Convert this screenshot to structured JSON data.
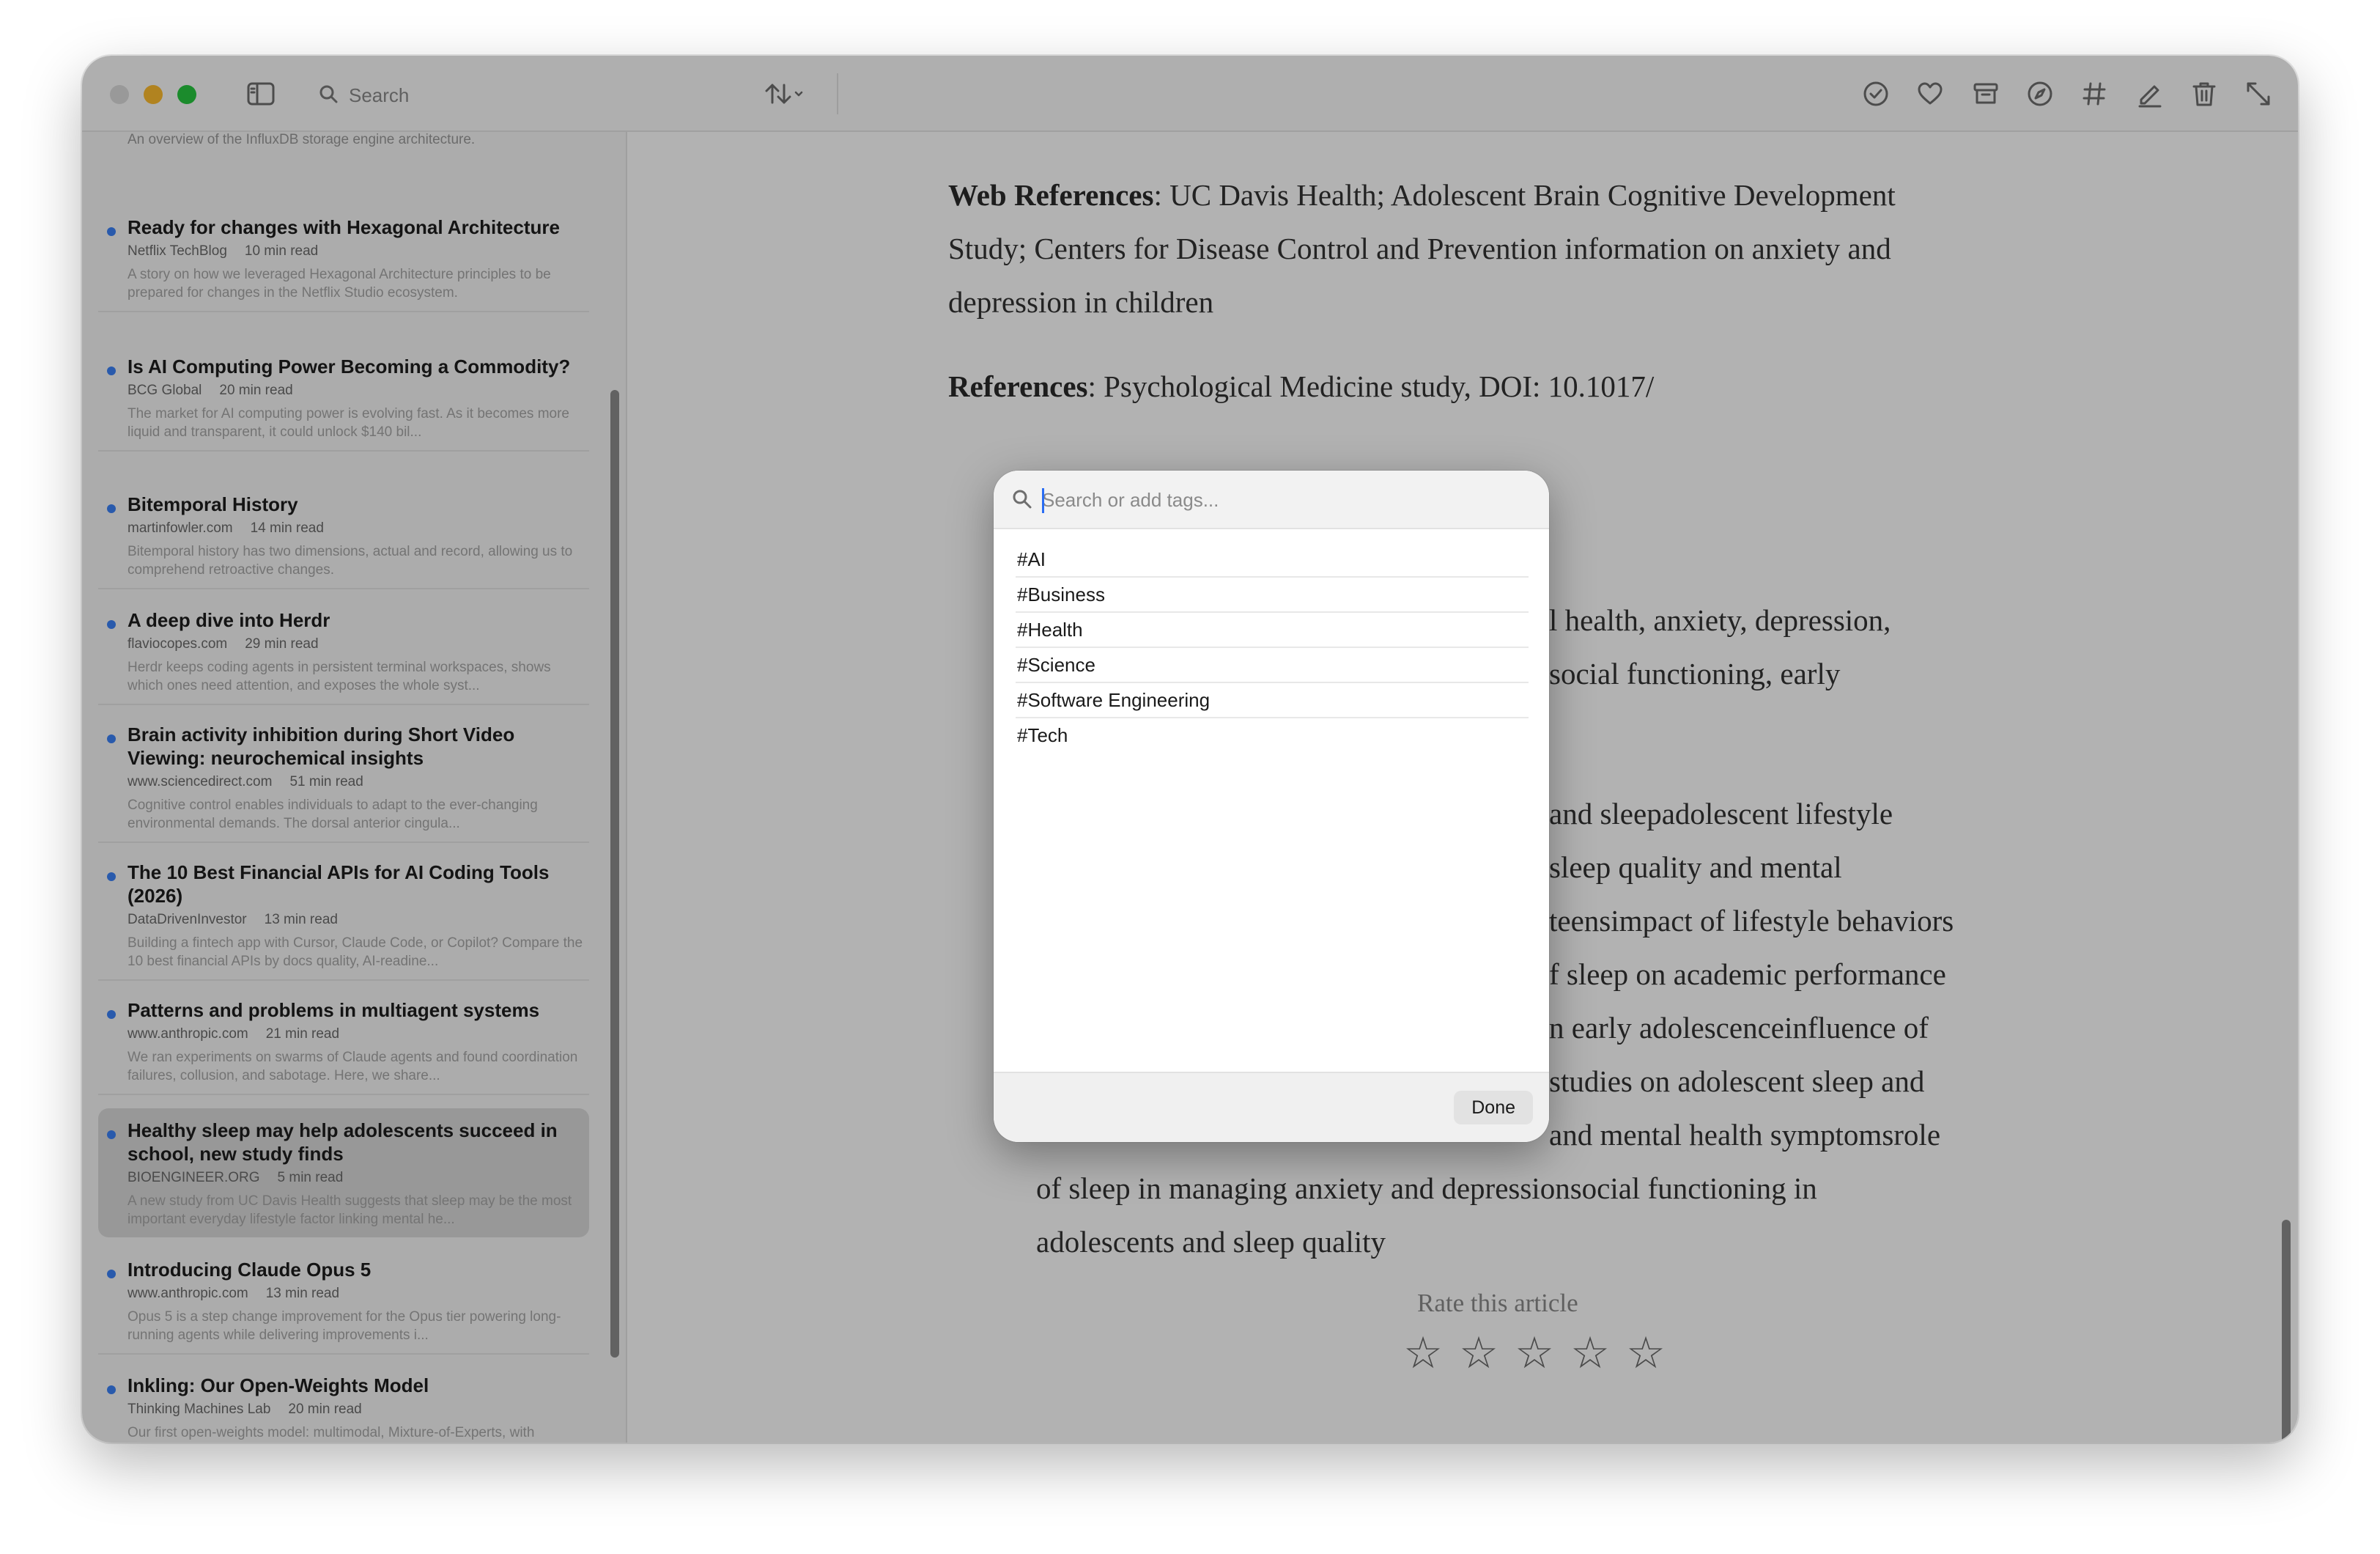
{
  "toolbar": {
    "search_label": "Search"
  },
  "sidebar": {
    "top_snippet": "An overview of the InfluxDB storage engine architecture.",
    "articles": [
      {
        "title": "Ready for changes with Hexagonal Architecture",
        "source": "Netflix TechBlog",
        "read_time": "10 min read",
        "excerpt": "A story on how we leveraged Hexagonal Architecture principles to be prepared for changes in the Netflix Studio ecosystem."
      },
      {
        "title": "Is AI Computing Power Becoming a Commodity?",
        "source": "BCG Global",
        "read_time": "20 min read",
        "excerpt": "The market for AI computing power is evolving fast. As it becomes more liquid and transparent, it could unlock $140 bil..."
      },
      {
        "title": "Bitemporal History",
        "source": "martinfowler.com",
        "read_time": "14 min read",
        "excerpt": "Bitemporal history has two dimensions, actual and record, allowing us to comprehend retroactive changes."
      },
      {
        "title": "A deep dive into Herdr",
        "source": "flaviocopes.com",
        "read_time": "29 min read",
        "excerpt": "Herdr keeps coding agents in persistent terminal workspaces, shows which ones need attention, and exposes the whole syst..."
      },
      {
        "title": "Brain activity inhibition during Short Video Viewing: neurochemical insights",
        "source": "www.sciencedirect.com",
        "read_time": "51 min read",
        "excerpt": "Cognitive control enables individuals to adapt to the ever-changing environmental demands. The dorsal anterior cingula..."
      },
      {
        "title": "The 10 Best Financial APIs for AI Coding Tools (2026)",
        "source": "DataDrivenInvestor",
        "read_time": "13 min read",
        "excerpt": "Building a fintech app with Cursor, Claude Code, or Copilot? Compare the 10 best financial APIs by docs quality, AI-readine..."
      },
      {
        "title": "Patterns and problems in multiagent systems",
        "source": "www.anthropic.com",
        "read_time": "21 min read",
        "excerpt": "We ran experiments on swarms of Claude agents and found coordination failures, collusion, and sabotage. Here, we share..."
      },
      {
        "title": "Healthy sleep may help adolescents succeed in school, new study finds",
        "source": "BIOENGINEER.ORG",
        "read_time": "5 min read",
        "excerpt": "A new study from UC Davis Health suggests that sleep may be the most important everyday lifestyle factor linking mental he...",
        "selected": true
      },
      {
        "title": "Introducing Claude Opus 5",
        "source": "www.anthropic.com",
        "read_time": "13 min read",
        "excerpt": "Opus 5 is a step change improvement for the Opus tier powering long-running agents while delivering improvements i..."
      },
      {
        "title": "Inkling: Our Open-Weights Model",
        "source": "Thinking Machines Lab",
        "read_time": "20 min read",
        "excerpt": "Our first open-weights model: multimodal, Mixture-of-Experts, with controllable reasoning effort. Available to fine-tune on Ti..."
      }
    ]
  },
  "reader": {
    "web_refs_label": "Web References",
    "web_refs_text": ": UC Davis Health; Adolescent Brain Cognitive Development Study; Centers for Disease Control and Prevention information on anxiety and depression in children",
    "refs_label": "References",
    "refs_text": ": Psychological Medicine study, DOI: 10.1017/",
    "line_frag_1": "l health, anxiety, depression,",
    "line_frag_2": "social functioning, early",
    "line_frag_3": "and sleepadolescent lifestyle",
    "line_frag_4": "sleep quality and mental",
    "line_frag_5": "teensimpact of lifestyle behaviors",
    "line_frag_6": "f sleep on academic performance",
    "line_frag_7": "n early adolescenceinfluence of",
    "line_frag_8": "studies on adolescent sleep and",
    "line_frag_9": "and mental health symptomsrole",
    "line_frag_10": "of sleep in managing anxiety and depressionsocial functioning in",
    "line_frag_11": "adolescents and sleep quality",
    "rate_label": "Rate this article",
    "rating": 0,
    "rating_max": 5
  },
  "tag_popover": {
    "placeholder": "Search or add tags...",
    "tags": [
      "#AI",
      "#Business",
      "#Health",
      "#Science",
      "#Software Engineering",
      "#Tech"
    ],
    "done_label": "Done"
  },
  "colors": {
    "unread_dot": "#3b82f6",
    "dim_overlay": "rgba(0,0,0,0.30)"
  }
}
